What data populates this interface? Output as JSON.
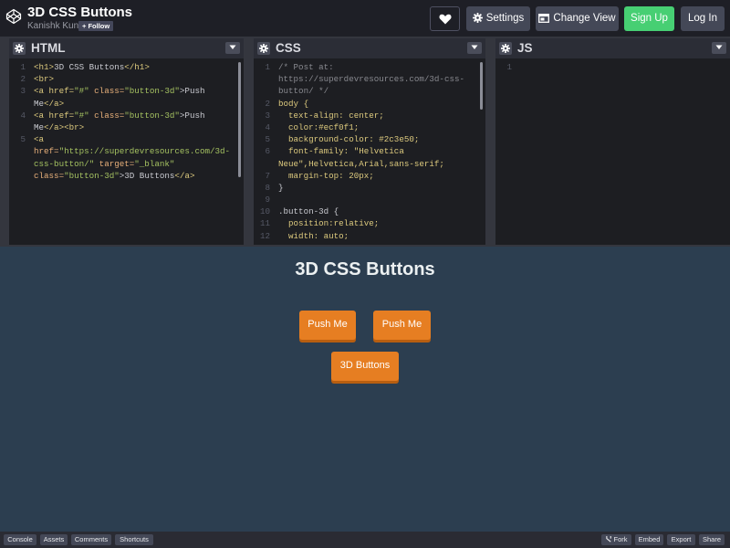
{
  "header": {
    "title": "3D CSS Buttons",
    "author": "Kanishk Kunal",
    "follow_label": "+ Follow",
    "settings_label": "Settings",
    "change_view_label": "Change View",
    "signup_label": "Sign Up",
    "login_label": "Log In"
  },
  "editors": {
    "html": {
      "title": "HTML",
      "line_numbers": [
        "1",
        "2",
        "3",
        "",
        "4",
        "",
        "5",
        "",
        "",
        ""
      ]
    },
    "css": {
      "title": "CSS",
      "line_numbers": [
        "1",
        "",
        "",
        "2",
        "3",
        "4",
        "5",
        "6",
        "",
        "7",
        "8",
        "9",
        "10",
        "11",
        "12"
      ]
    },
    "js": {
      "title": "JS",
      "line_numbers": [
        "1"
      ]
    }
  },
  "code": {
    "html": [
      [
        "<h1>",
        "3D CSS Buttons",
        "</h1>"
      ],
      [
        "<br>"
      ],
      [
        "<a href=",
        "\"#\"",
        " class=",
        "\"button-3d\"",
        ">Push"
      ],
      [
        "Me",
        "</a>"
      ],
      [
        "<a href=",
        "\"#\"",
        " class=",
        "\"button-3d\"",
        ">Push"
      ],
      [
        "Me",
        "</a><br>"
      ],
      [
        "<a"
      ],
      [
        "href=",
        "\"https://superdevresources.com/3d-"
      ],
      [
        "css-button/\"",
        " target=",
        "\"_blank\""
      ],
      [
        "class=",
        "\"button-3d\"",
        ">3D Buttons",
        "</a>"
      ]
    ],
    "css": [
      "/* Post at:",
      "https://superdevresources.com/3d-css-",
      "button/ */",
      "body {",
      "  text-align: center;",
      "  color:#ecf0f1;",
      "  background-color: #2c3e50;",
      "  font-family: \"Helvetica",
      "Neue\",Helvetica,Arial,sans-serif;",
      "  margin-top: 20px;",
      "}",
      "",
      ".button-3d {",
      "  position:relative;",
      "  width: auto;"
    ]
  },
  "preview": {
    "heading": "3D CSS Buttons",
    "buttons": [
      "Push Me",
      "Push Me",
      "3D Buttons"
    ],
    "colors": {
      "background": "#2c3e50",
      "text": "#ecf0f1",
      "button": "#e67e22"
    }
  },
  "footer": {
    "console": "Console",
    "assets": "Assets",
    "comments": "Comments",
    "shortcuts": "Shortcuts",
    "fork": "Fork",
    "embed": "Embed",
    "export": "Export",
    "share": "Share"
  },
  "icons": {
    "logo": "codepen-logo-icon",
    "heart": "heart-icon",
    "settings": "gear-icon",
    "change_view": "layout-icon",
    "pane_settings": "gear-icon",
    "pane_collapse": "chevron-down-icon",
    "fork": "fork-icon"
  },
  "brand_colors": {
    "signup": "#47cf73",
    "button_gray": "#444857"
  }
}
